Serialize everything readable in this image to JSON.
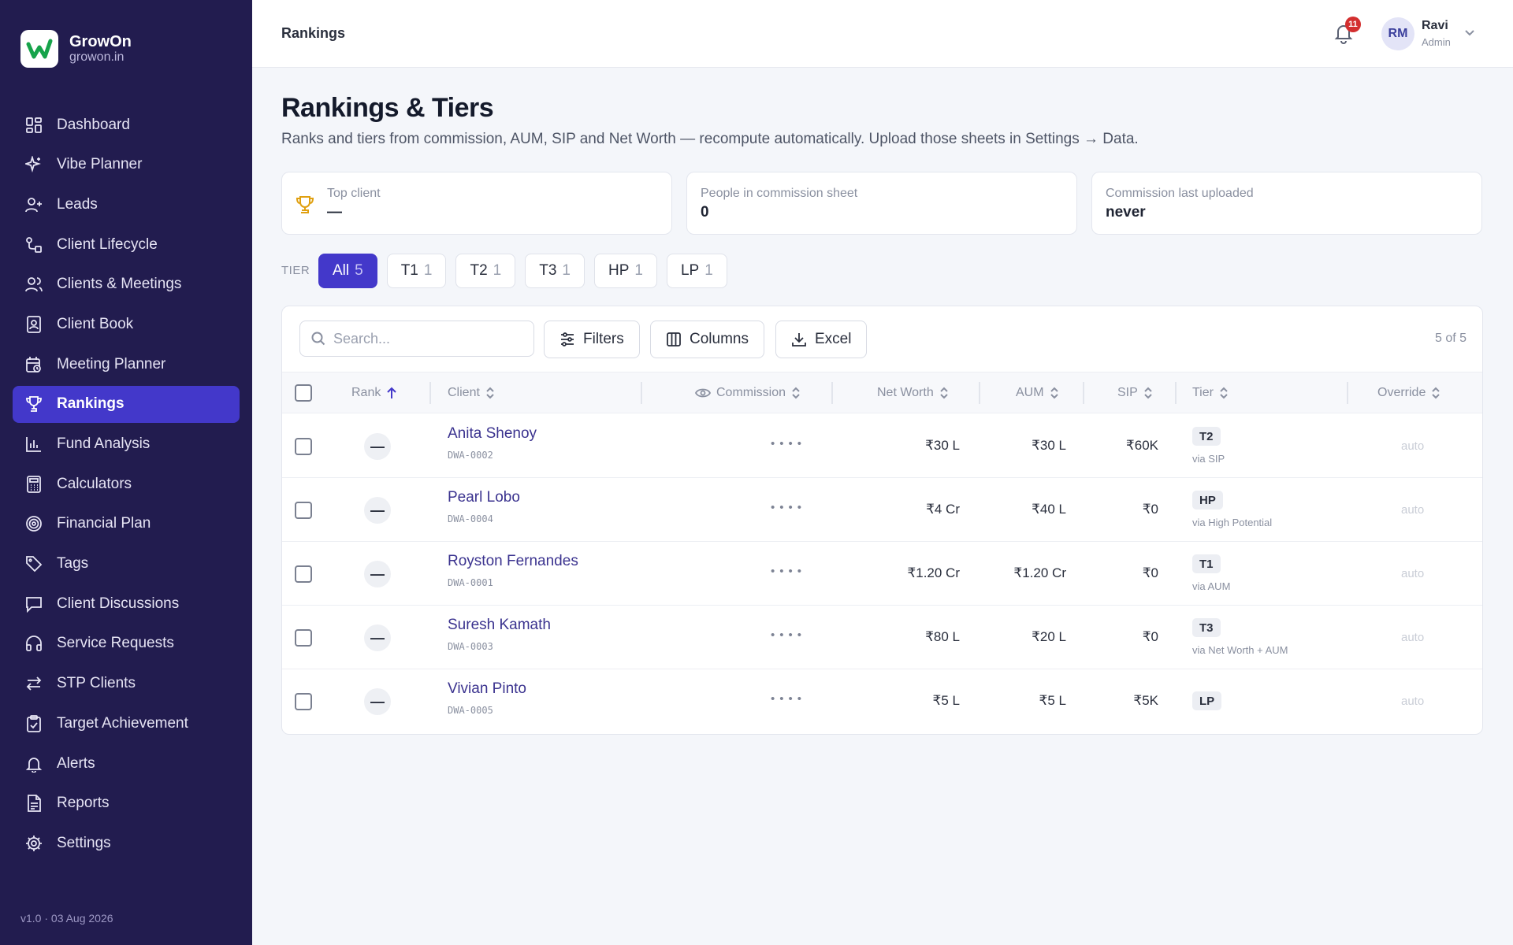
{
  "app": {
    "name": "GrowOn",
    "domain": "growon.in",
    "version": "v1.0 · 03 Aug 2026",
    "accent": "#4338ca",
    "sidebar_bg": "#221c4f"
  },
  "nav": [
    {
      "label": "Dashboard",
      "icon": "dashboard-icon"
    },
    {
      "label": "Vibe Planner",
      "icon": "sparkle-icon"
    },
    {
      "label": "Leads",
      "icon": "user-plus-icon"
    },
    {
      "label": "Client Lifecycle",
      "icon": "lifecycle-icon"
    },
    {
      "label": "Clients & Meetings",
      "icon": "users-icon"
    },
    {
      "label": "Client Book",
      "icon": "contact-book-icon"
    },
    {
      "label": "Meeting Planner",
      "icon": "calendar-clock-icon"
    },
    {
      "label": "Rankings",
      "icon": "trophy-icon",
      "active": true
    },
    {
      "label": "Fund Analysis",
      "icon": "bar-chart-icon"
    },
    {
      "label": "Calculators",
      "icon": "calculator-icon"
    },
    {
      "label": "Financial Plan",
      "icon": "target-icon"
    },
    {
      "label": "Tags",
      "icon": "tag-icon"
    },
    {
      "label": "Client Discussions",
      "icon": "message-icon"
    },
    {
      "label": "Service Requests",
      "icon": "headphones-icon"
    },
    {
      "label": "STP Clients",
      "icon": "transfer-icon"
    },
    {
      "label": "Target Achievement",
      "icon": "clipboard-check-icon"
    },
    {
      "label": "Alerts",
      "icon": "bell-icon"
    },
    {
      "label": "Reports",
      "icon": "file-text-icon"
    },
    {
      "label": "Settings",
      "icon": "gear-icon"
    }
  ],
  "header": {
    "breadcrumb": "Rankings",
    "notifications": "11",
    "user_initials": "RM",
    "user_name": "Ravi",
    "user_role": "Admin"
  },
  "page": {
    "title": "Rankings & Tiers",
    "subtitle": "Ranks and tiers from commission, AUM, SIP and Net Worth — recompute automatically. Upload those sheets in Settings → Data."
  },
  "stats": [
    {
      "label": "Top client",
      "value": "—"
    },
    {
      "label": "People in commission sheet",
      "value": "0"
    },
    {
      "label": "Commission last uploaded",
      "value": "never"
    }
  ],
  "tier_filter": {
    "label": "TIER",
    "chips": [
      {
        "label": "All",
        "count": "5",
        "active": true
      },
      {
        "label": "T1",
        "count": "1"
      },
      {
        "label": "T2",
        "count": "1"
      },
      {
        "label": "T3",
        "count": "1"
      },
      {
        "label": "HP",
        "count": "1"
      },
      {
        "label": "LP",
        "count": "1"
      }
    ]
  },
  "toolbar": {
    "search_placeholder": "Search...",
    "filters_label": "Filters",
    "columns_label": "Columns",
    "excel_label": "Excel",
    "row_count": "5 of 5"
  },
  "columns": {
    "rank": "Rank",
    "client": "Client",
    "commission": "Commission",
    "net_worth": "Net Worth",
    "aum": "AUM",
    "sip": "SIP",
    "tier": "Tier",
    "override": "Override"
  },
  "rows": [
    {
      "rank": "—",
      "name": "Anita Shenoy",
      "id": "DWA-0002",
      "commission": "••••",
      "net_worth": "₹30 L",
      "aum": "₹30 L",
      "sip": "₹60K",
      "tier": "T2",
      "via": "via SIP",
      "override": "auto"
    },
    {
      "rank": "—",
      "name": "Pearl Lobo",
      "id": "DWA-0004",
      "commission": "••••",
      "net_worth": "₹4 Cr",
      "aum": "₹40 L",
      "sip": "₹0",
      "tier": "HP",
      "via": "via High Potential",
      "override": "auto"
    },
    {
      "rank": "—",
      "name": "Royston Fernandes",
      "id": "DWA-0001",
      "commission": "••••",
      "net_worth": "₹1.20 Cr",
      "aum": "₹1.20 Cr",
      "sip": "₹0",
      "tier": "T1",
      "via": "via AUM",
      "override": "auto"
    },
    {
      "rank": "—",
      "name": "Suresh Kamath",
      "id": "DWA-0003",
      "commission": "••••",
      "net_worth": "₹80 L",
      "aum": "₹20 L",
      "sip": "₹0",
      "tier": "T3",
      "via": "via Net Worth + AUM",
      "override": "auto"
    },
    {
      "rank": "—",
      "name": "Vivian Pinto",
      "id": "DWA-0005",
      "commission": "••••",
      "net_worth": "₹5 L",
      "aum": "₹5 L",
      "sip": "₹5K",
      "tier": "LP",
      "via": "",
      "override": "auto"
    }
  ]
}
